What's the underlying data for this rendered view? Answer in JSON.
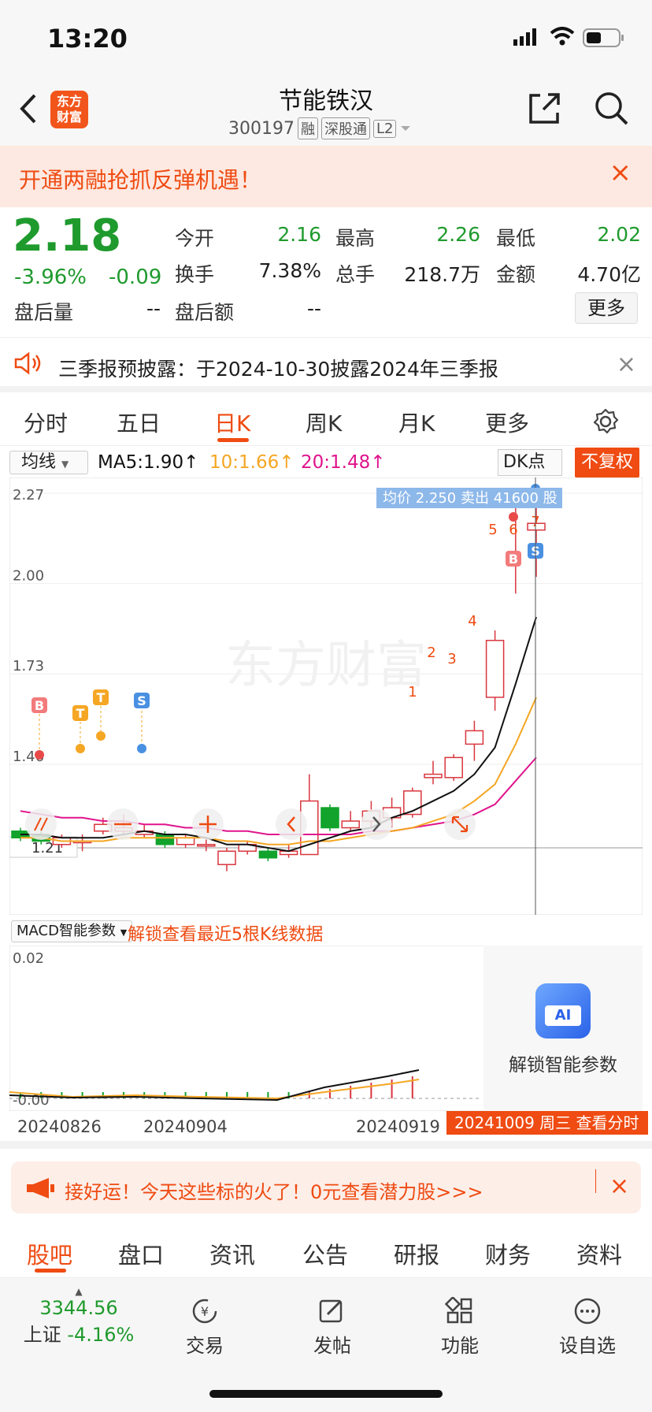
{
  "status_bar": {
    "time": "13:20"
  },
  "header": {
    "logo_text_1": "东方",
    "logo_text_2": "财富",
    "stock_name": "节能铁汉",
    "stock_code": "300197",
    "tags": [
      "融",
      "深股通",
      "L2"
    ]
  },
  "promo": {
    "text": "开通两融抢抓反弹机遇！",
    "close": "×"
  },
  "quote": {
    "price": "2.18",
    "change_pct": "-3.96%",
    "change_abs": "-0.09",
    "fields": [
      {
        "label": "今开",
        "value": "2.16",
        "color": "#1f9a2d"
      },
      {
        "label": "最高",
        "value": "2.26",
        "color": "#1f9a2d"
      },
      {
        "label": "最低",
        "value": "2.02",
        "color": "#1f9a2d"
      },
      {
        "label": "换手",
        "value": "7.38%",
        "color": "#222222"
      },
      {
        "label": "总手",
        "value": "218.7万",
        "color": "#222222"
      },
      {
        "label": "金额",
        "value": "4.70亿",
        "color": "#222222"
      },
      {
        "label": "盘后量",
        "value": "--",
        "color": "#222222"
      },
      {
        "label": "盘后额",
        "value": "--",
        "color": "#222222"
      }
    ],
    "more_label": "更多"
  },
  "notice": {
    "text": "三季报预披露：于2024-10-30披露2024年三季报",
    "close": "×"
  },
  "chart_tabs": [
    "分时",
    "五日",
    "日K",
    "周K",
    "月K",
    "更多"
  ],
  "active_tab": "日K",
  "ma_line": {
    "selector": "均线",
    "ma5": "MA5:1.90↑",
    "ma10": "10:1.66↑",
    "ma20": "20:1.48↑",
    "dk": "DK点",
    "fq": "不复权",
    "colors": {
      "ma5": "#111111",
      "ma10": "#f5a623",
      "ma20": "#e0148c"
    }
  },
  "chart_data": {
    "type": "candlestick",
    "y_ticks": [
      "2.27",
      "2.00",
      "1.73",
      "1.46"
    ],
    "low_label": "1.21",
    "ylim": [
      1.21,
      2.27
    ],
    "candles": [
      {
        "o": 1.26,
        "c": 1.24,
        "h": 1.27,
        "l": 1.23
      },
      {
        "o": 1.25,
        "c": 1.23,
        "h": 1.26,
        "l": 1.22
      },
      {
        "o": 1.22,
        "c": 1.24,
        "h": 1.25,
        "l": 1.21
      },
      {
        "o": 1.23,
        "c": 1.23,
        "h": 1.25,
        "l": 1.2
      },
      {
        "o": 1.26,
        "c": 1.28,
        "h": 1.3,
        "l": 1.25
      },
      {
        "o": 1.26,
        "c": 1.27,
        "h": 1.31,
        "l": 1.25
      },
      {
        "o": 1.25,
        "c": 1.26,
        "h": 1.28,
        "l": 1.24
      },
      {
        "o": 1.25,
        "c": 1.22,
        "h": 1.26,
        "l": 1.21
      },
      {
        "o": 1.22,
        "c": 1.24,
        "h": 1.25,
        "l": 1.21
      },
      {
        "o": 1.22,
        "c": 1.22,
        "h": 1.24,
        "l": 1.2
      },
      {
        "o": 1.16,
        "c": 1.2,
        "h": 1.21,
        "l": 1.14
      },
      {
        "o": 1.2,
        "c": 1.22,
        "h": 1.23,
        "l": 1.19
      },
      {
        "o": 1.2,
        "c": 1.18,
        "h": 1.21,
        "l": 1.17
      },
      {
        "o": 1.19,
        "c": 1.2,
        "h": 1.22,
        "l": 1.18
      },
      {
        "o": 1.19,
        "c": 1.35,
        "h": 1.43,
        "l": 1.19
      },
      {
        "o": 1.33,
        "c": 1.27,
        "h": 1.34,
        "l": 1.26
      },
      {
        "o": 1.27,
        "c": 1.29,
        "h": 1.32,
        "l": 1.26
      },
      {
        "o": 1.29,
        "c": 1.32,
        "h": 1.35,
        "l": 1.27
      },
      {
        "o": 1.3,
        "c": 1.33,
        "h": 1.36,
        "l": 1.27
      },
      {
        "o": 1.31,
        "c": 1.38,
        "h": 1.39,
        "l": 1.3
      },
      {
        "o": 1.42,
        "c": 1.43,
        "h": 1.47,
        "l": 1.4
      },
      {
        "o": 1.42,
        "c": 1.48,
        "h": 1.49,
        "l": 1.41
      },
      {
        "o": 1.52,
        "c": 1.56,
        "h": 1.59,
        "l": 1.47
      },
      {
        "o": 1.66,
        "c": 1.83,
        "h": 1.86,
        "l": 1.62
      },
      {
        "o": 2.24,
        "c": 2.27,
        "h": 2.27,
        "l": 1.97
      },
      {
        "o": 2.16,
        "c": 2.18,
        "h": 2.26,
        "l": 2.02
      }
    ],
    "ma5": [
      1.25,
      1.25,
      1.24,
      1.24,
      1.24,
      1.25,
      1.26,
      1.25,
      1.25,
      1.24,
      1.22,
      1.22,
      1.21,
      1.2,
      1.22,
      1.24,
      1.26,
      1.27,
      1.3,
      1.32,
      1.35,
      1.38,
      1.43,
      1.51,
      1.7,
      1.9
    ],
    "ma10": [
      1.24,
      1.24,
      1.23,
      1.23,
      1.23,
      1.24,
      1.24,
      1.24,
      1.24,
      1.24,
      1.23,
      1.23,
      1.22,
      1.22,
      1.23,
      1.23,
      1.24,
      1.25,
      1.26,
      1.27,
      1.29,
      1.31,
      1.35,
      1.4,
      1.52,
      1.66
    ],
    "ma20": [
      1.32,
      1.31,
      1.3,
      1.3,
      1.29,
      1.29,
      1.28,
      1.28,
      1.27,
      1.27,
      1.26,
      1.26,
      1.25,
      1.25,
      1.25,
      1.25,
      1.25,
      1.26,
      1.26,
      1.27,
      1.28,
      1.29,
      1.31,
      1.34,
      1.41,
      1.48
    ],
    "markers": [
      "B",
      "T",
      "T",
      "S",
      "1",
      "2",
      "3",
      "4",
      "5",
      "6",
      "B",
      "7",
      "S"
    ],
    "avg_tip": "均价 2.250 卖出 41600 股"
  },
  "watermark": "东方财富",
  "macd": {
    "selector": "MACD智能参数",
    "unlock_text": "解锁查看最近5根K线数据",
    "y_top": "0.02",
    "y_bottom": "-0.00",
    "ai_label": "解锁智能参数",
    "ai_icon_text": "AI"
  },
  "dates": {
    "d1": "20240826",
    "d2": "20240904",
    "d3": "20240919",
    "tip": "20241009 周三 查看分时"
  },
  "banner": {
    "text": "接好运！今天这些标的火了！0元查看潜力股>>>",
    "close": "×"
  },
  "sub_tabs": [
    "股吧",
    "盘口",
    "资讯",
    "公告",
    "研报",
    "财务",
    "资料"
  ],
  "bottom": {
    "index_value": "3344.56",
    "index_name": "上证",
    "index_change": "-4.16%",
    "items": [
      "交易",
      "发帖",
      "功能",
      "设自选"
    ]
  }
}
